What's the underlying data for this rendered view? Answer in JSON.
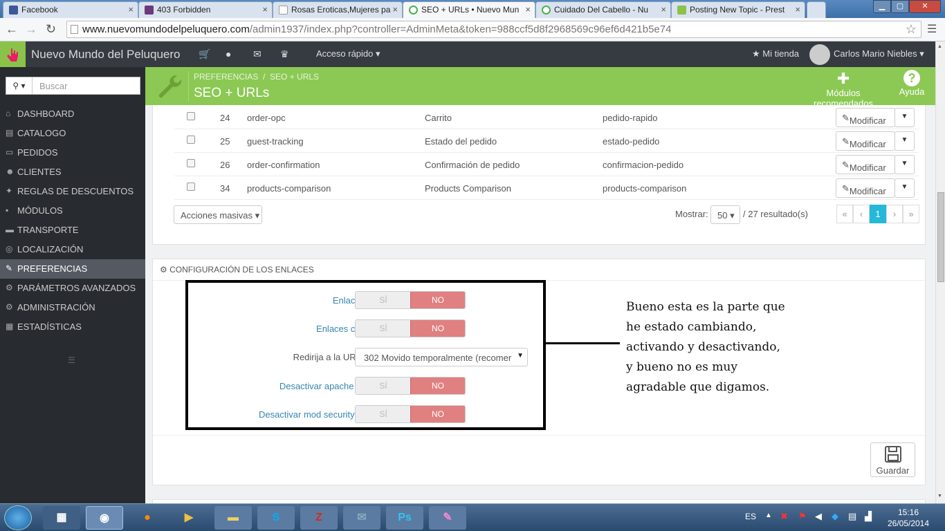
{
  "browser": {
    "tabs": [
      {
        "title": "Facebook",
        "color": "#3b5998"
      },
      {
        "title": "403 Forbidden",
        "color": "#6b3a7a"
      },
      {
        "title": "Rosas Eroticas,Mujeres pa",
        "color": "#ffffff"
      },
      {
        "title": "SEO + URLs • Nuevo Mun",
        "color": "#4caf50"
      },
      {
        "title": "Cuidado Del Cabello - Nu",
        "color": "#4caf50"
      },
      {
        "title": "Posting New Topic - Prest",
        "color": "#8bc34a"
      }
    ],
    "url_host": "www.nuevomundodelpeluquero.com",
    "url_path": "/admin1937/index.php?controller=AdminMeta&token=988ccf5d8f2968569c96ef6d421b5e74"
  },
  "header": {
    "shop_name": "Nuevo Mundo del Peluquero",
    "quick_access": "Acceso rápido",
    "my_shop": "Mi tienda",
    "user": "Carlos Mario Niebles"
  },
  "page": {
    "breadcrumb_1": "PREFERENCIAS",
    "breadcrumb_2": "SEO + URLS",
    "title": "SEO + URLs",
    "recommended_modules": "Módulos recomendados",
    "help": "Ayuda"
  },
  "sidebar": {
    "search_placeholder": "Buscar",
    "items": [
      {
        "label": "DASHBOARD",
        "icon": "⌂"
      },
      {
        "label": "CATALOGO",
        "icon": "▤"
      },
      {
        "label": "PEDIDOS",
        "icon": "▭"
      },
      {
        "label": "CLIENTES",
        "icon": "☻"
      },
      {
        "label": "REGLAS DE DESCUENTOS",
        "icon": "✦"
      },
      {
        "label": "MÓDULOS",
        "icon": "▪"
      },
      {
        "label": "TRANSPORTE",
        "icon": "▬"
      },
      {
        "label": "LOCALIZACIÓN",
        "icon": "◎"
      },
      {
        "label": "PREFERENCIAS",
        "icon": "✎"
      },
      {
        "label": "PARÁMETROS AVANZADOS",
        "icon": "⚙"
      },
      {
        "label": "ADMINISTRACIÓN",
        "icon": "⚙"
      },
      {
        "label": "ESTADÍSTICAS",
        "icon": "▦"
      }
    ]
  },
  "table": {
    "rows": [
      {
        "id": "24",
        "page": "order-opc",
        "title": "Carrito",
        "url": "pedido-rapido"
      },
      {
        "id": "25",
        "page": "guest-tracking",
        "title": "Estado del pedido",
        "url": "estado-pedido"
      },
      {
        "id": "26",
        "page": "order-confirmation",
        "title": "Confirmación de pedido",
        "url": "confirmacion-pedido"
      },
      {
        "id": "34",
        "page": "products-comparison",
        "title": "Products Comparison",
        "url": "products-comparison"
      }
    ],
    "edit_label": "Modificar",
    "bulk_actions": "Acciones masivas",
    "show_label": "Mostrar:",
    "per_page": "50",
    "results": "/ 27 resultado(s)",
    "current_page": "1"
  },
  "config": {
    "heading": "CONFIGURACIÓN DE LOS ENLACES",
    "yes": "SÍ",
    "no": "NO",
    "fields": [
      {
        "label": "Enlace amigable",
        "value": "NO"
      },
      {
        "label": "Enlaces con acentos",
        "value": "NO"
      },
      {
        "label": "Desactivar apache MultiViews",
        "value": "NO"
      },
      {
        "label": "Desactivar mod security en apache",
        "value": "NO"
      }
    ],
    "canonical_label": "Redirija a la URL canónica",
    "canonical_value": "302 Movido temporalmente (recomer",
    "save": "Guardar"
  },
  "annotation": "Bueno esta es la parte que he estado cambiando, activando y desactivando, y bueno no es muy agradable que digamos.",
  "taskbar": {
    "lang": "ES",
    "time": "15:16",
    "date": "26/05/2014"
  }
}
